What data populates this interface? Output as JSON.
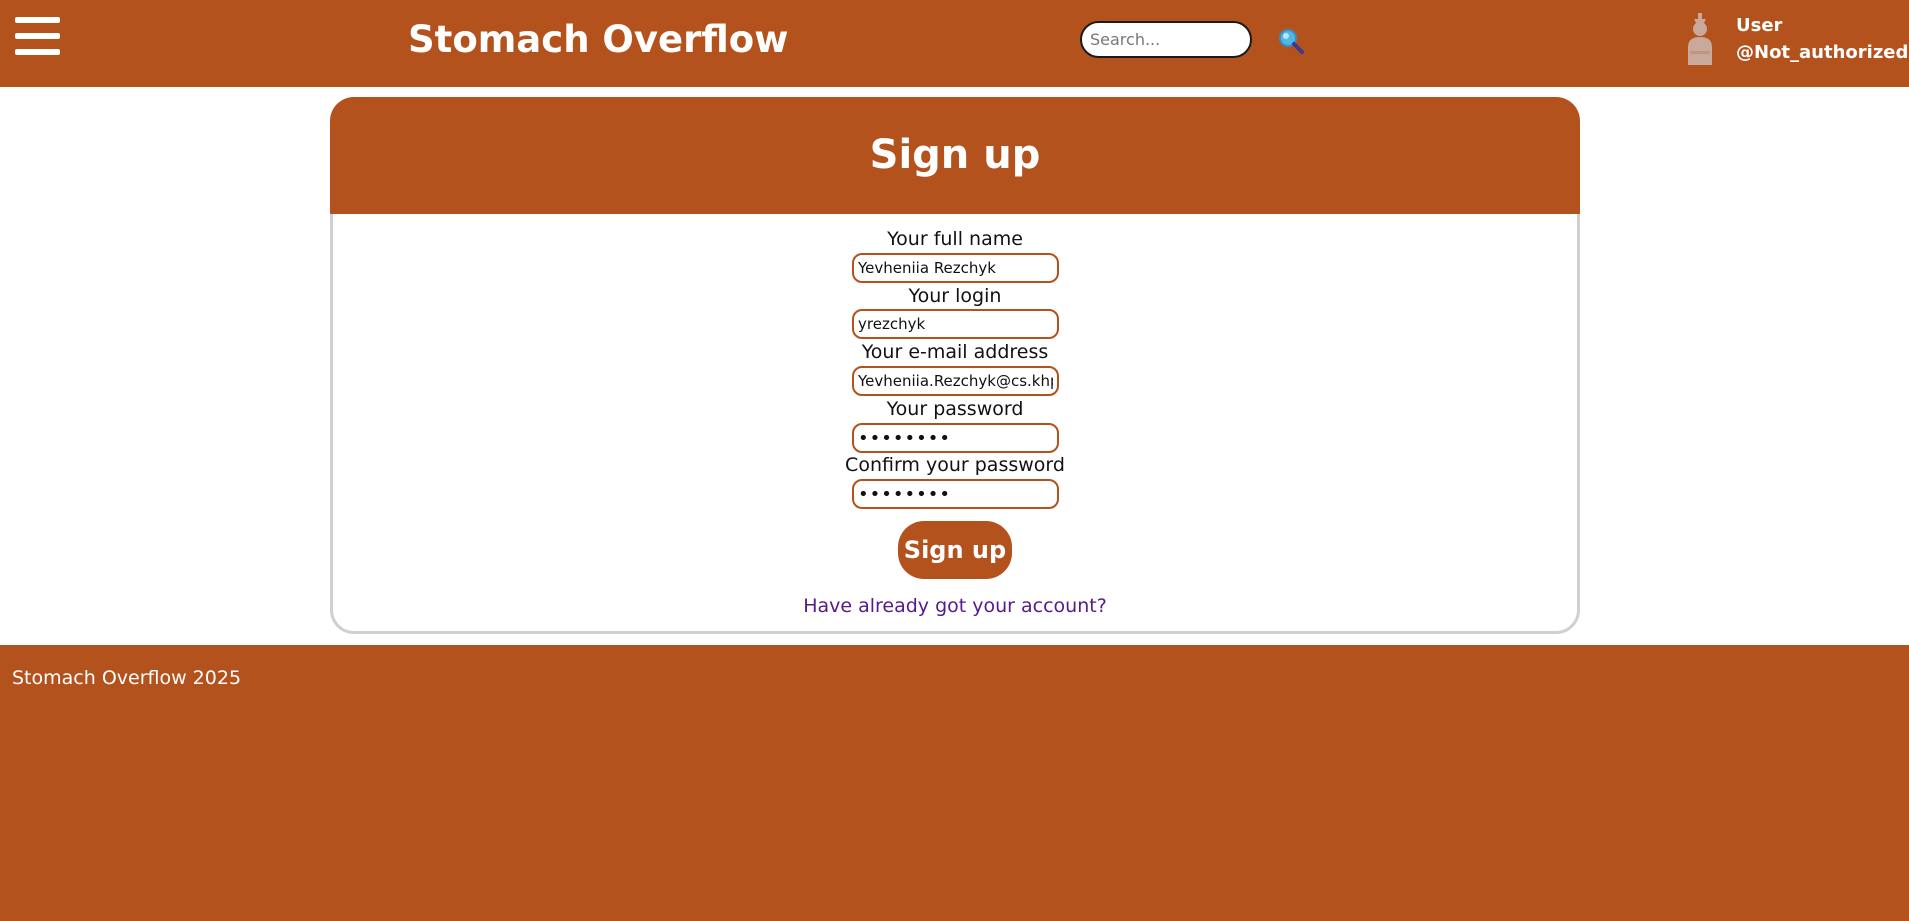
{
  "header": {
    "menu_icon": "hamburger-menu-icon",
    "site_title": "Stomach Overflow",
    "search": {
      "placeholder": "Search...",
      "value": ""
    },
    "search_icon": "magnifier-icon",
    "user": {
      "avatar_icon": "user-silhouette-icon",
      "name": "User",
      "handle": "@Not_authorized"
    }
  },
  "signup": {
    "title": "Sign up",
    "fields": [
      {
        "label": "Your full name",
        "value": "Yevheniia Rezchyk",
        "type": "text"
      },
      {
        "label": "Your login",
        "value": "yrezchyk",
        "type": "text"
      },
      {
        "label": "Your e-mail address",
        "value": "Yevheniia.Rezchyk@cs.khp",
        "type": "email"
      },
      {
        "label": "Your password",
        "value": "••••••••",
        "type": "password"
      },
      {
        "label": "Confirm your password",
        "value": "••••••••",
        "type": "password"
      }
    ],
    "submit_label": "Sign up",
    "login_link": "Have already got your account?"
  },
  "footer": {
    "text": "Stomach Overflow 2025"
  },
  "colors": {
    "brand": "#b3521d",
    "link": "#551a8b",
    "card_border": "#d0d0d0",
    "background": "#ffffff"
  }
}
